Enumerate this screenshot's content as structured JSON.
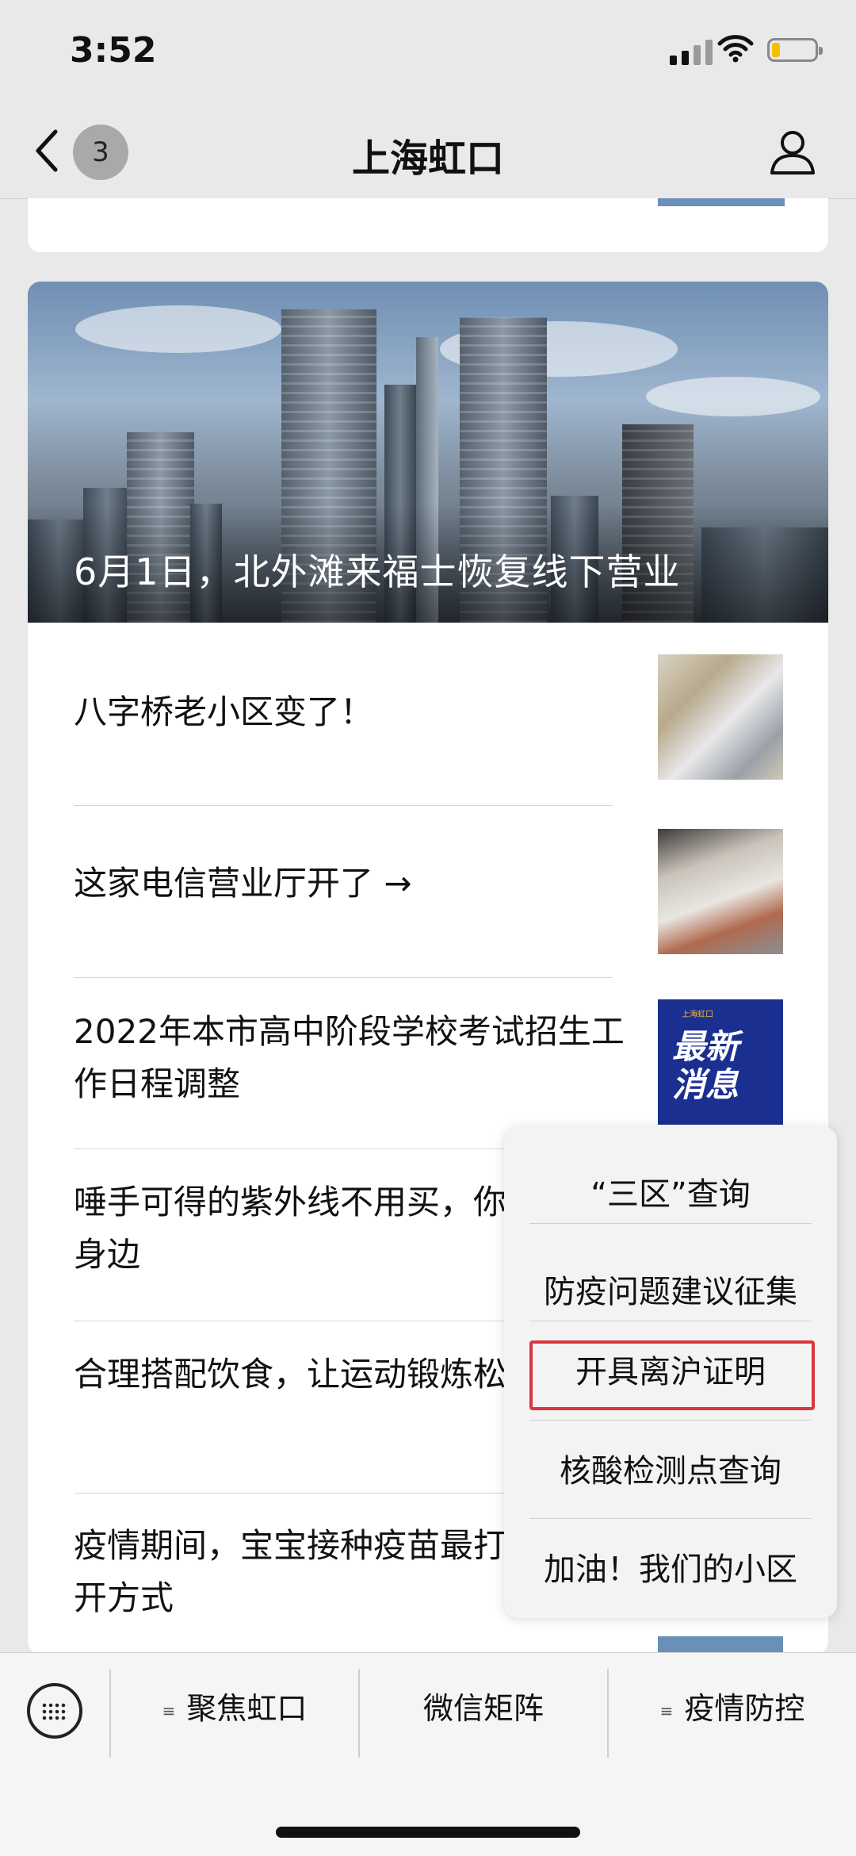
{
  "status_bar": {
    "time": "3:52"
  },
  "nav": {
    "back_count": "3",
    "title": "上海虹口"
  },
  "hero": {
    "title": "6月1日，北外滩来福士恢复线下营业"
  },
  "articles": [
    {
      "title": "八字桥老小区变了！"
    },
    {
      "title": "这家电信营业厅开了 →"
    },
    {
      "title": "2022年本市高中阶段学校考试招生工作日程调整",
      "thumb_text": "最新消息",
      "thumb_caption": "上海虹口"
    },
    {
      "title": "唾手可得的紫外线不用买，你身边"
    },
    {
      "title": "合理搭配饮食，让运动锻炼松"
    },
    {
      "title": "疫情期间，宝宝接种疫苗最打开方式"
    }
  ],
  "menu_popup": {
    "items": [
      "“三区”查询",
      "防疫问题建议征集",
      "开具离沪证明",
      "核酸检测点查询",
      "加油！我们的小区"
    ],
    "highlighted_index": 2,
    "highlight_color": "#d9363e"
  },
  "bottom_menu": {
    "tabs": [
      "聚焦虹口",
      "微信矩阵",
      "疫情防控"
    ]
  }
}
